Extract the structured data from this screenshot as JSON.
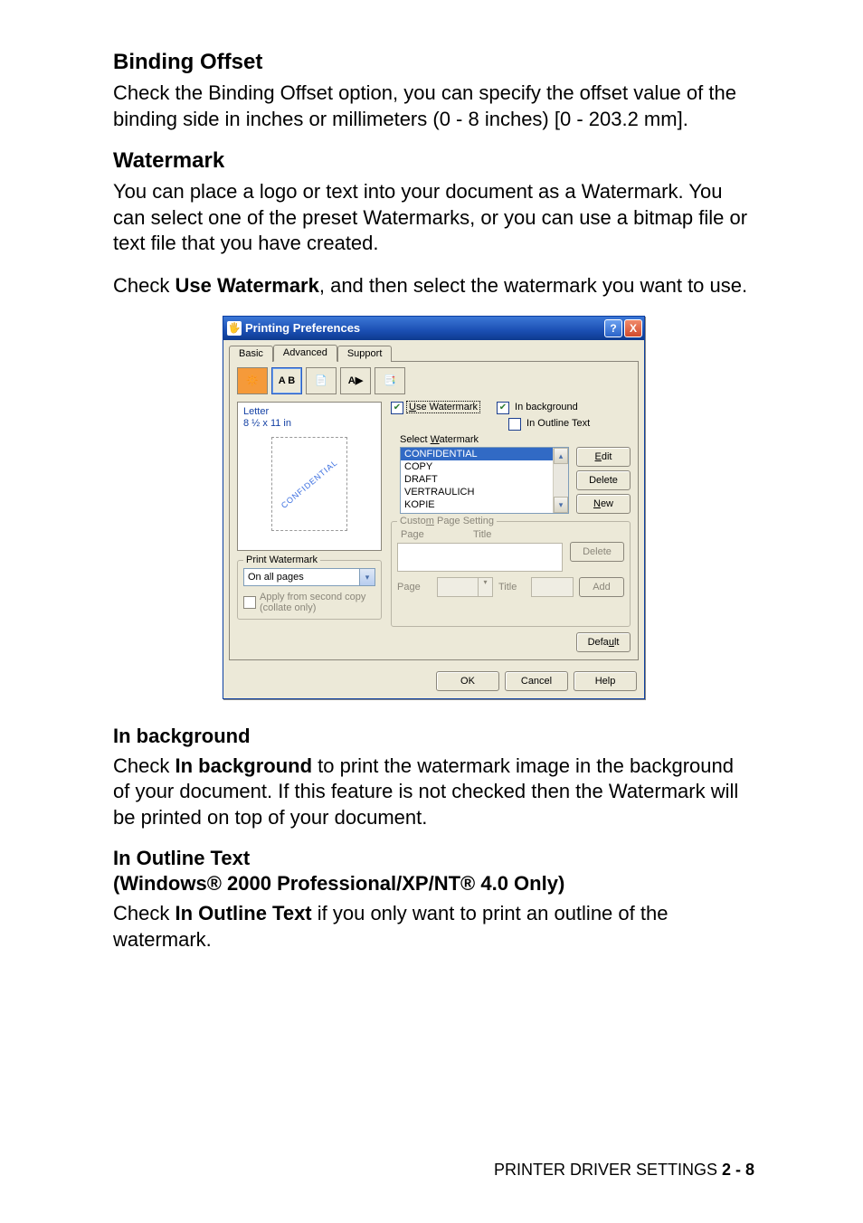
{
  "headings": {
    "binding_offset": "Binding Offset",
    "watermark": "Watermark",
    "in_background": "In background",
    "in_outline": "In Outline Text"
  },
  "paragraphs": {
    "binding_offset_body": "Check the Binding Offset option, you can specify the offset value of the binding side in inches or millimeters (0 - 8 inches) [0 - 203.2 mm].",
    "watermark_body1": "You can place a logo or text into your document as a Watermark. You can select one of the preset Watermarks, or you can use a bitmap file or text file that you have created.",
    "watermark_body2_pre": "Check ",
    "watermark_body2_bold": "Use Watermark",
    "watermark_body2_post": ", and then select the watermark you want to use.",
    "in_background_pre": "Check ",
    "in_background_bold": "In background",
    "in_background_post": " to print the watermark image in the background of your document. If this feature is not checked then the Watermark will be printed on top of your document.",
    "in_outline_subtitle_pre": "(Windows",
    "in_outline_subtitle_mid": " 2000 Professional/XP/NT",
    "in_outline_subtitle_post": " 4.0 Only)",
    "in_outline_reg": "®",
    "in_outline_body_pre": "Check ",
    "in_outline_body_bold": "In Outline Text",
    "in_outline_body_post": " if you only want to print an outline of the watermark."
  },
  "footer": {
    "label": "PRINTER DRIVER SETTINGS   ",
    "page": "2 - 8"
  },
  "dialog": {
    "title": "Printing Preferences",
    "help": "?",
    "close": "X",
    "tabs": {
      "basic": "Basic",
      "advanced": "Advanced",
      "support": "Support"
    },
    "toolbar": {
      "i1": "A B",
      "i3": "A",
      "i4": "✎"
    },
    "paper": {
      "name": "Letter",
      "size": "8 ½ x 11 in"
    },
    "preview_text": "CONFIDENTIAL",
    "use_watermark": {
      "label_u": "U",
      "label_rest": "se Watermark"
    },
    "in_bg": {
      "label": " In background"
    },
    "in_outline": {
      "label": " In Outline Text"
    },
    "select_wm": {
      "pre": "Select ",
      "u": "W",
      "post": "atermark"
    },
    "list": [
      "CONFIDENTIAL",
      "COPY",
      "DRAFT",
      "VERTRAULICH",
      "KOPIE"
    ],
    "buttons": {
      "edit_u": "E",
      "edit_rest": "dit",
      "delete": "Delete",
      "new_u": "N",
      "new_rest": "ew"
    },
    "print_wm_group": "Print Watermark",
    "print_wm_value": "On all pages",
    "apply_second": "Apply from second copy\n(collate only)",
    "cps": {
      "title_pre": "Custo",
      "title_u": "m",
      "title_post": " Page Setting",
      "col_page": "Page",
      "col_title": "Title",
      "delete": "Delete",
      "page_lbl": "Page",
      "title_lbl": "Title",
      "add": "Add"
    },
    "default_pre": "Defa",
    "default_u": "u",
    "default_post": "lt",
    "ok": "OK",
    "cancel": "Cancel",
    "helpbtn": "Help"
  }
}
